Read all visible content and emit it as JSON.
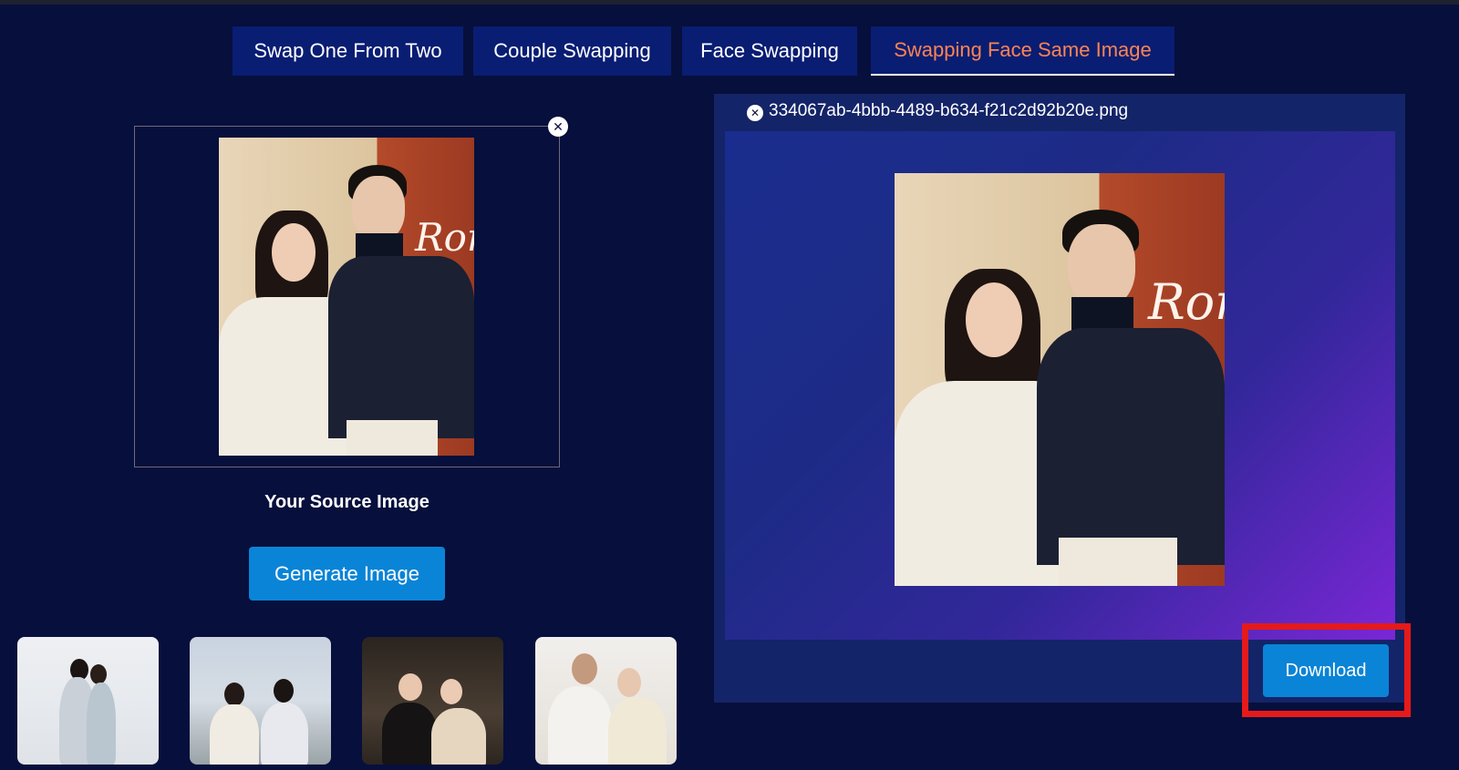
{
  "tabs": [
    {
      "label": "Swap One From Two",
      "active": false
    },
    {
      "label": "Couple Swapping",
      "active": false
    },
    {
      "label": "Face Swapping",
      "active": false
    },
    {
      "label": "Swapping Face Same Image",
      "active": true
    }
  ],
  "source": {
    "label": "Your Source Image",
    "close_icon": "close-icon",
    "generate_label": "Generate Image"
  },
  "result": {
    "file_name": "334067ab-4bbb-4489-b634-f21c2d92b20e.png",
    "close_icon": "close-icon",
    "download_label": "Download"
  },
  "thumbnails": [
    {
      "name": "sample-1"
    },
    {
      "name": "sample-2"
    },
    {
      "name": "sample-3"
    },
    {
      "name": "sample-4"
    }
  ],
  "colors": {
    "background": "#070f3c",
    "tab_bg": "#091d73",
    "active_tab_text": "#ff8452",
    "button": "#0a84d6",
    "highlight": "#e51a1a"
  }
}
